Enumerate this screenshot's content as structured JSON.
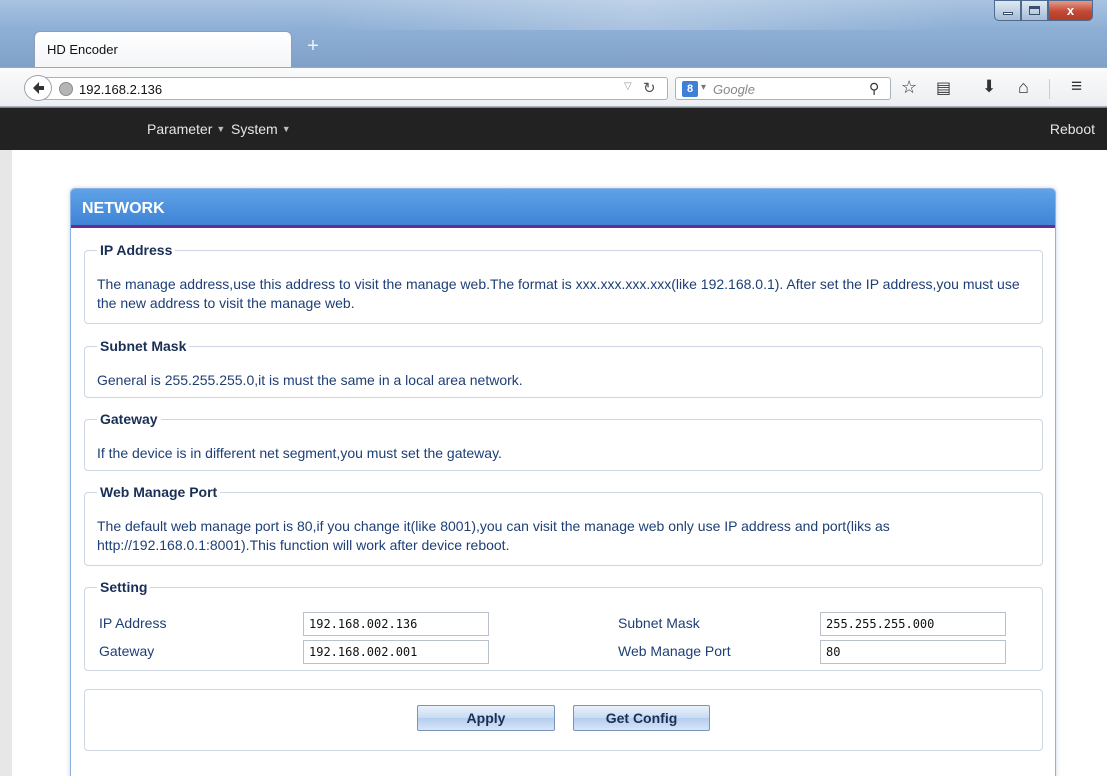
{
  "browser": {
    "tab_title": "HD Encoder",
    "new_tab": "+",
    "url": "192.168.2.136",
    "search_engine": "8",
    "search_placeholder": "Google",
    "window_buttons": {
      "minimize": "minimize",
      "maximize": "maximize",
      "close": "x"
    }
  },
  "appbar": {
    "menus": [
      {
        "label": "Parameter"
      },
      {
        "label": "System"
      }
    ],
    "reboot": "Reboot"
  },
  "panel": {
    "title": "NETWORK",
    "sections": [
      {
        "legend": "IP Address",
        "text": "The manage address,use this address to visit the manage web.The format is xxx.xxx.xxx.xxx(like 192.168.0.1). After set the IP address,you must use the new address to visit the manage web."
      },
      {
        "legend": "Subnet Mask",
        "text": "General is 255.255.255.0,it is must the same in a local area network."
      },
      {
        "legend": "Gateway",
        "text": "If the device is in different net segment,you must set the gateway."
      },
      {
        "legend": "Web Manage Port",
        "text": "The default web manage port is 80,if you change it(like 8001),you can visit the manage web only use IP address and port(liks as http://192.168.0.1:8001).This function will work after device reboot."
      }
    ],
    "setting": {
      "legend": "Setting",
      "fields": [
        {
          "label": "IP Address",
          "value": "192.168.002.136"
        },
        {
          "label": "Subnet Mask",
          "value": "255.255.255.000"
        },
        {
          "label": "Gateway",
          "value": "192.168.002.001"
        },
        {
          "label": "Web Manage Port",
          "value": "80"
        }
      ]
    },
    "buttons": {
      "apply": "Apply",
      "get_config": "Get Config"
    }
  },
  "colors": {
    "panel_header": "#4a8fdd",
    "panel_header_border": "#6b2c91",
    "legend_text": "#1a2f56",
    "body_text": "#1d3f76",
    "appbar_bg": "#222222"
  }
}
